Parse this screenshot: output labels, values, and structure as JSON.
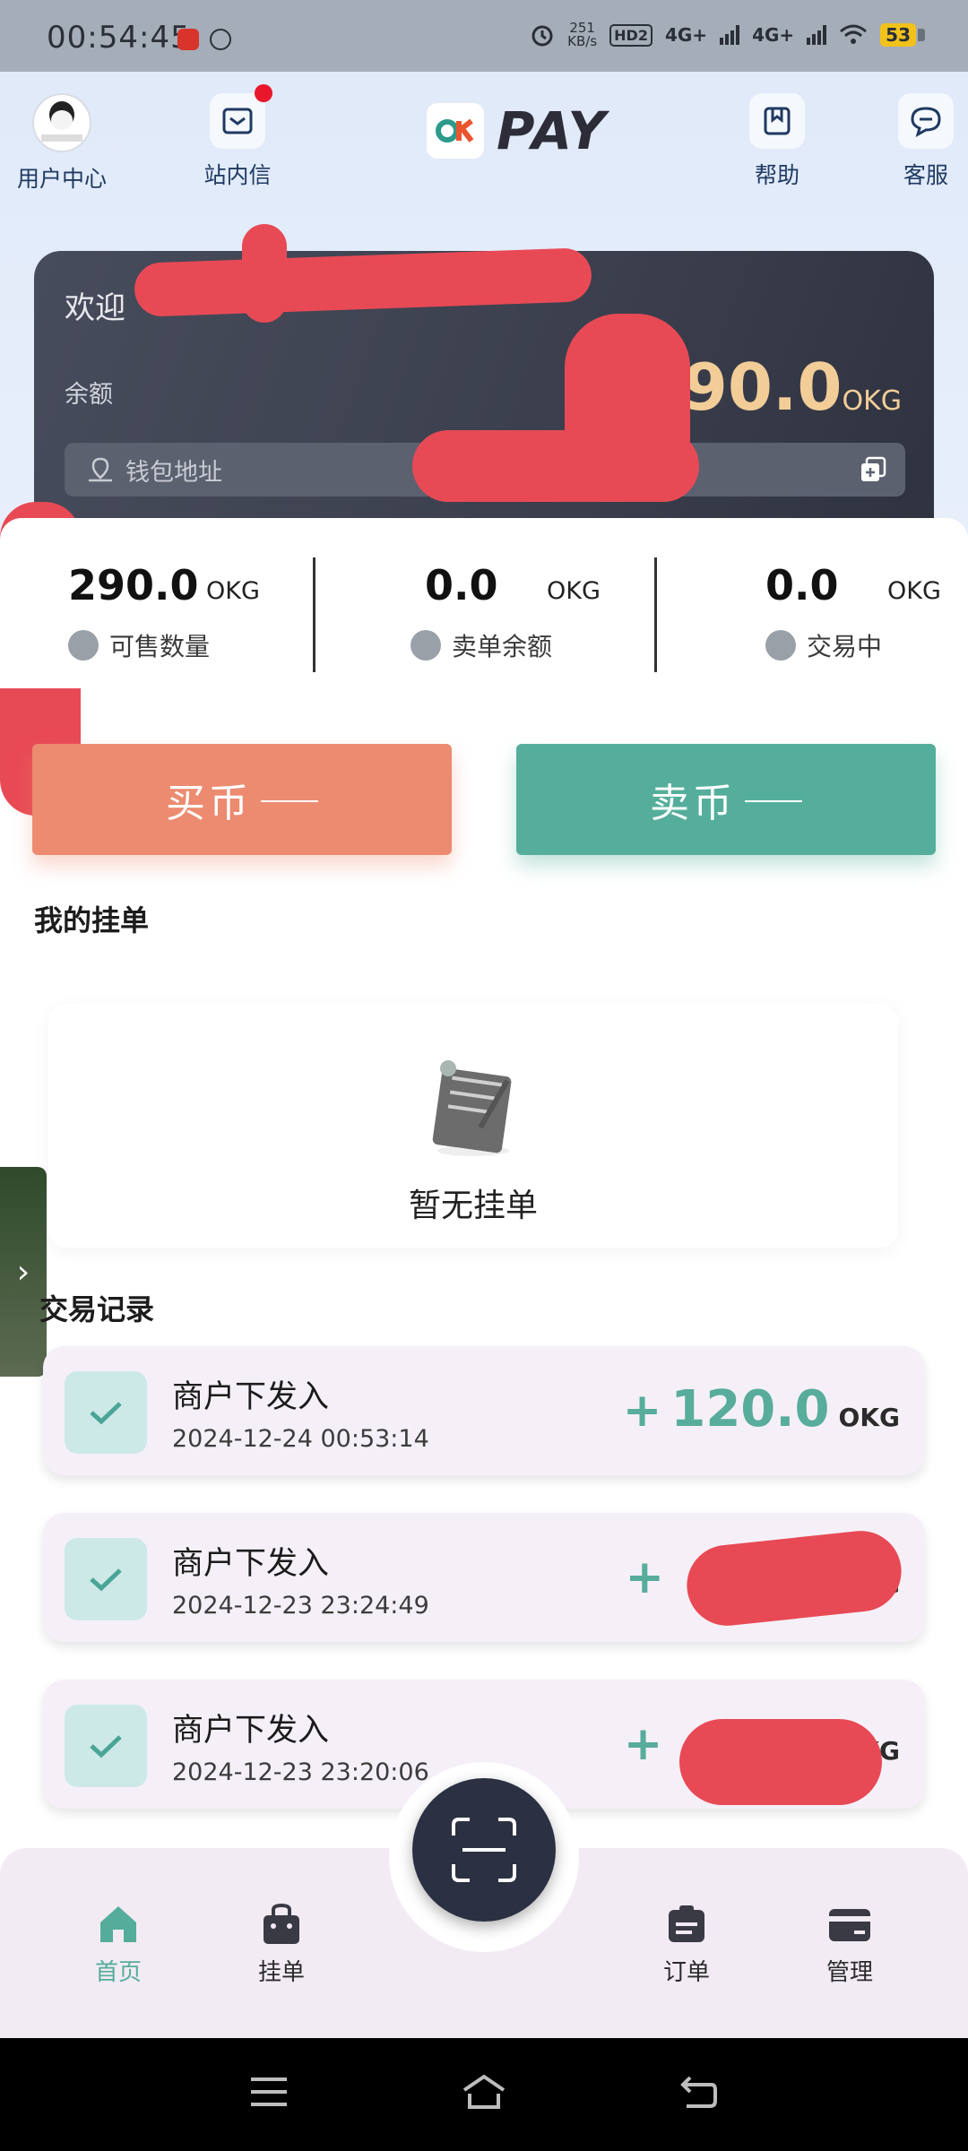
{
  "status_bar": {
    "time": "00:54:45",
    "speed_value": "251",
    "speed_unit": "KB/s",
    "hd_badge": "HD2",
    "net1": "4G+",
    "net2": "4G+",
    "battery": "53"
  },
  "header": {
    "user_center": "用户中心",
    "messages": "站内信",
    "brand": "PAY",
    "help": "帮助",
    "support": "客服"
  },
  "wallet": {
    "welcome": "欢迎",
    "balance_label": "余额",
    "balance_value": "290.0",
    "balance_unit": "OKG",
    "address_placeholder": "钱包地址"
  },
  "stats": [
    {
      "value": "290.0",
      "unit": "OKG",
      "label": "可售数量"
    },
    {
      "value": "0.0",
      "unit": "OKG",
      "label": "卖单余额"
    },
    {
      "value": "0.0",
      "unit": "OKG",
      "label": "交易中"
    }
  ],
  "actions": {
    "buy": "买币",
    "sell": "卖币"
  },
  "my_orders": {
    "title": "我的挂单",
    "empty_text": "暂无挂单"
  },
  "transactions": {
    "title": "交易记录",
    "items": [
      {
        "title": "商户下发入",
        "time": "2024-12-24 00:53:14",
        "sign": "+",
        "amount": "120.0",
        "unit": "OKG"
      },
      {
        "title": "商户下发入",
        "time": "2024-12-23 23:24:49",
        "sign": "+",
        "amount": "",
        "unit": "G"
      },
      {
        "title": "商户下发入",
        "time": "2024-12-23 23:20:06",
        "sign": "+",
        "amount": "",
        "unit": "KG"
      }
    ]
  },
  "bottom_nav": {
    "home": "首页",
    "orders_list": "挂单",
    "orders": "订单",
    "manage": "管理"
  },
  "colors": {
    "accent_green": "#55ae9b",
    "accent_orange": "#ec8b70",
    "card_dark": "#3b3f4d",
    "gold": "#f2cd98"
  }
}
